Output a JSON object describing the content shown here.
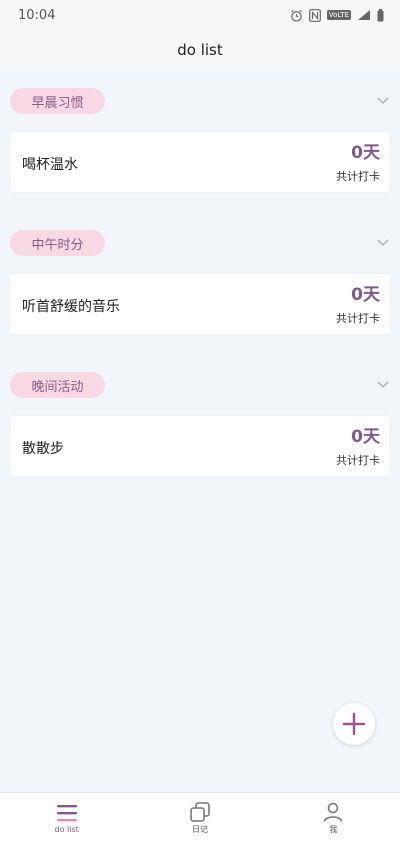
{
  "status_bar": {
    "time": "10:04",
    "volte_label": "VoLTE"
  },
  "header": {
    "title": "do list"
  },
  "sections": [
    {
      "label": "早晨习惯",
      "cards": [
        {
          "title": "喝杯温水",
          "days": "0天",
          "total_label": "共计打卡"
        }
      ]
    },
    {
      "label": "中午时分",
      "cards": [
        {
          "title": "听首舒缓的音乐",
          "days": "0天",
          "total_label": "共计打卡"
        }
      ]
    },
    {
      "label": "晚间活动",
      "cards": [
        {
          "title": "散散步",
          "days": "0天",
          "total_label": "共计打卡"
        }
      ]
    }
  ],
  "fab": {
    "icon": "plus-icon"
  },
  "bottom_nav": [
    {
      "label": "do list",
      "icon": "list-icon",
      "active": true
    },
    {
      "label": "日记",
      "icon": "diary-icon",
      "active": false
    },
    {
      "label": "我",
      "icon": "person-icon",
      "active": false
    }
  ],
  "colors": {
    "accent": "#7d5a8e",
    "tag_bg": "#f7d8e3",
    "page_bg": "#f2f5fa"
  }
}
